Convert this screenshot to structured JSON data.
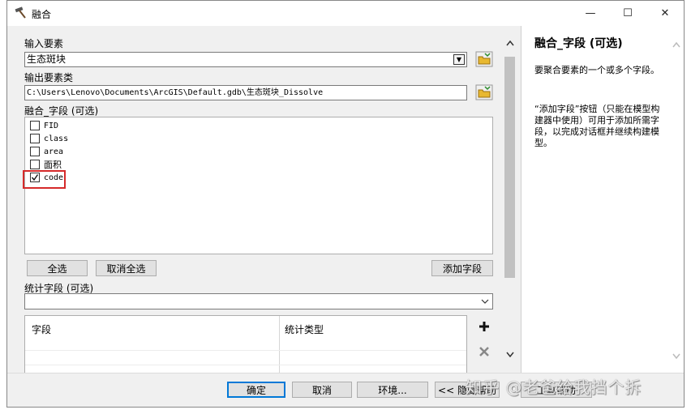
{
  "window": {
    "title": "融合",
    "icon": "hammer-icon",
    "minimize_glyph": "—",
    "maximize_glyph": "☐",
    "close_glyph": "✕"
  },
  "form": {
    "input_label": "输入要素",
    "input_value": "生态斑块",
    "output_label": "输出要素类",
    "output_value": "C:\\Users\\Lenovo\\Documents\\ArcGIS\\Default.gdb\\生态斑块_Dissolve",
    "dissolve_label": "融合_字段 (可选)",
    "fields": [
      {
        "label": "FID",
        "checked": false
      },
      {
        "label": "class",
        "checked": false
      },
      {
        "label": "area",
        "checked": false
      },
      {
        "label": "面积",
        "checked": false
      },
      {
        "label": "code",
        "checked": true
      }
    ],
    "select_all": "全选",
    "unselect_all": "取消全选",
    "add_field": "添加字段",
    "stats_label": "统计字段 (可选)",
    "stats_columns": [
      "字段",
      "统计类型"
    ]
  },
  "help": {
    "title": "融合_字段 (可选)",
    "para1": "要聚合要素的一个或多个字段。",
    "para2": "“添加字段”按钮（只能在模型构建器中使用）可用于添加所需字段，以完成对话框并继续构建模型。"
  },
  "buttons": {
    "ok": "确定",
    "cancel": "取消",
    "env": "环境...",
    "hide_help": "<< 隐藏帮助",
    "tool_help": "工具帮助"
  },
  "watermark": "知乎 @老爸给我挡个拆",
  "colors": {
    "highlight": "#d52a2a",
    "ok_border": "#0078d7"
  }
}
